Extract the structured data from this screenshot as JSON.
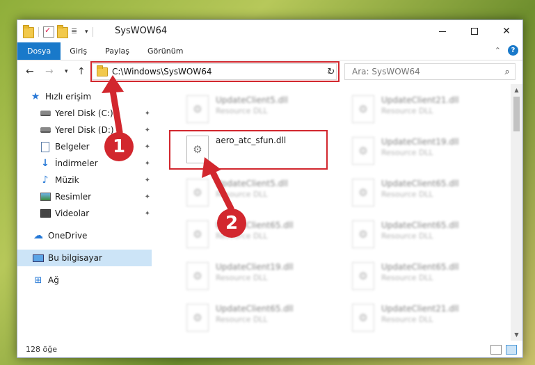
{
  "window": {
    "title": "SysWOW64"
  },
  "ribbon": {
    "tabs": [
      "Dosya",
      "Giriş",
      "Paylaş",
      "Görünüm"
    ]
  },
  "address": {
    "path": "C:\\Windows\\SysWOW64"
  },
  "search": {
    "placeholder": "Ara: SysWOW64"
  },
  "sidebar": {
    "items": [
      {
        "label": "Hızlı erişim",
        "icon": "star-icon"
      },
      {
        "label": "Yerel Disk (C:)",
        "icon": "drive-icon"
      },
      {
        "label": "Yerel Disk (D:)",
        "icon": "drive-icon"
      },
      {
        "label": "Belgeler",
        "icon": "documents-icon"
      },
      {
        "label": "İndirmeler",
        "icon": "downloads-icon"
      },
      {
        "label": "Müzik",
        "icon": "music-icon"
      },
      {
        "label": "Resimler",
        "icon": "pictures-icon"
      },
      {
        "label": "Videolar",
        "icon": "videos-icon"
      },
      {
        "label": "OneDrive",
        "icon": "onedrive-icon"
      },
      {
        "label": "Bu bilgisayar",
        "icon": "computer-icon"
      },
      {
        "label": "Ağ",
        "icon": "network-icon"
      }
    ]
  },
  "files": {
    "highlighted": {
      "name": "aero_atc_sfun.dll"
    },
    "background": [
      {
        "name": "UpdateClient5.dll",
        "desc": "Resource DLL"
      },
      {
        "name": "UpdateClient21.dll",
        "desc": "Resource DLL"
      },
      {
        "name": "UpdateClient19.dll",
        "desc": "Resource DLL"
      },
      {
        "name": "UpdateClient5.dll",
        "desc": "Resource DLL"
      },
      {
        "name": "UpdateClient65.dll",
        "desc": "Resource DLL"
      },
      {
        "name": "UpdateClient65.dll",
        "desc": "Resource DLL"
      },
      {
        "name": "UpdateClient65.dll",
        "desc": "Resource DLL"
      },
      {
        "name": "UpdateClient19.dll",
        "desc": "Resource DLL"
      },
      {
        "name": "UpdateClient65.dll",
        "desc": "Resource DLL"
      },
      {
        "name": "UpdateClient65.dll",
        "desc": "Resource DLL"
      },
      {
        "name": "UpdateClient21.dll",
        "desc": "Resource DLL"
      }
    ]
  },
  "status": {
    "count": "128 öğe"
  },
  "annotations": {
    "step1": "1",
    "step2": "2",
    "color": "#d2272e"
  }
}
